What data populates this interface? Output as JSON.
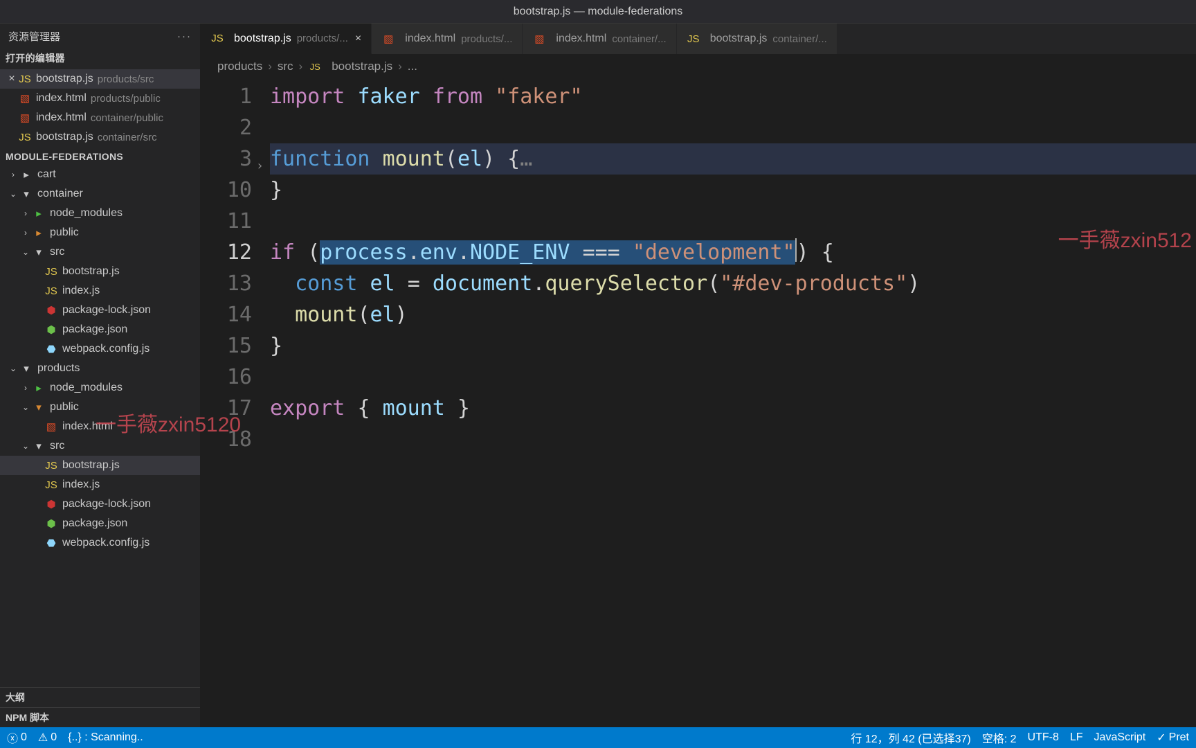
{
  "window_title": "bootstrap.js — module-federations",
  "sidebar": {
    "header": "资源管理器",
    "open_editors_label": "打开的编辑器",
    "project_label": "MODULE-FEDERATIONS",
    "outline_label": "大纲",
    "npm_label": "NPM 脚本"
  },
  "open_editors": [
    {
      "icon": "js",
      "name": "bootstrap.js",
      "path": "products/src",
      "active": true
    },
    {
      "icon": "html",
      "name": "index.html",
      "path": "products/public",
      "active": false
    },
    {
      "icon": "html",
      "name": "index.html",
      "path": "container/public",
      "active": false
    },
    {
      "icon": "js",
      "name": "bootstrap.js",
      "path": "container/src",
      "active": false
    }
  ],
  "tree": [
    {
      "indent": 0,
      "chev": "right",
      "icon": "folder",
      "name": "cart"
    },
    {
      "indent": 0,
      "chev": "down",
      "icon": "folder",
      "name": "container"
    },
    {
      "indent": 1,
      "chev": "right",
      "icon": "folder-green",
      "name": "node_modules"
    },
    {
      "indent": 1,
      "chev": "right",
      "icon": "folder-orange",
      "name": "public"
    },
    {
      "indent": 1,
      "chev": "down",
      "icon": "folder",
      "name": "src"
    },
    {
      "indent": 2,
      "chev": "",
      "icon": "js",
      "name": "bootstrap.js"
    },
    {
      "indent": 2,
      "chev": "",
      "icon": "js",
      "name": "index.js"
    },
    {
      "indent": 2,
      "chev": "",
      "icon": "npm",
      "name": "package-lock.json"
    },
    {
      "indent": 2,
      "chev": "",
      "icon": "nodejs",
      "name": "package.json"
    },
    {
      "indent": 2,
      "chev": "",
      "icon": "webpack",
      "name": "webpack.config.js"
    },
    {
      "indent": 0,
      "chev": "down",
      "icon": "folder",
      "name": "products"
    },
    {
      "indent": 1,
      "chev": "right",
      "icon": "folder-green",
      "name": "node_modules"
    },
    {
      "indent": 1,
      "chev": "down",
      "icon": "folder-orange",
      "name": "public"
    },
    {
      "indent": 2,
      "chev": "",
      "icon": "html",
      "name": "index.html"
    },
    {
      "indent": 1,
      "chev": "down",
      "icon": "folder",
      "name": "src"
    },
    {
      "indent": 2,
      "chev": "",
      "icon": "js",
      "name": "bootstrap.js",
      "active": true
    },
    {
      "indent": 2,
      "chev": "",
      "icon": "js",
      "name": "index.js"
    },
    {
      "indent": 2,
      "chev": "",
      "icon": "npm",
      "name": "package-lock.json"
    },
    {
      "indent": 2,
      "chev": "",
      "icon": "nodejs",
      "name": "package.json"
    },
    {
      "indent": 2,
      "chev": "",
      "icon": "webpack",
      "name": "webpack.config.js"
    }
  ],
  "tabs": [
    {
      "icon": "js",
      "name": "bootstrap.js",
      "path": "products/...",
      "active": true,
      "close": true
    },
    {
      "icon": "html",
      "name": "index.html",
      "path": "products/...",
      "active": false,
      "close": false
    },
    {
      "icon": "html",
      "name": "index.html",
      "path": "container/...",
      "active": false,
      "close": false
    },
    {
      "icon": "js",
      "name": "bootstrap.js",
      "path": "container/...",
      "active": false,
      "close": false
    }
  ],
  "breadcrumbs": [
    "products",
    "src",
    "bootstrap.js",
    "..."
  ],
  "code": {
    "lines": [
      "1",
      "2",
      "3",
      "10",
      "11",
      "12",
      "13",
      "14",
      "15",
      "16",
      "17",
      "18"
    ],
    "active_line": "12",
    "l1_import": "import",
    "l1_faker1": "faker",
    "l1_from": "from",
    "l1_faker2": "\"faker\"",
    "l3_function": "function",
    "l3_mount": "mount",
    "l3_el": "el",
    "l3_ellipsis": "…",
    "l10_brace": "}",
    "l12_if": "if",
    "l12_process": "process",
    "l12_env": "env",
    "l12_node": "NODE_ENV",
    "l12_eq": "===",
    "l12_dev": "\"development\"",
    "l13_const": "const",
    "l13_el": "el",
    "l13_doc": "document",
    "l13_qs": "querySelector",
    "l13_sel": "\"#dev-products\"",
    "l14_mount": "mount",
    "l14_el": "el",
    "l15_brace": "}",
    "l17_export": "export",
    "l17_mount": "mount"
  },
  "watermarks": {
    "w1": "一手薇zxin5120",
    "w2": "一手薇zxin512"
  },
  "status": {
    "errors": "0",
    "warnings": "0",
    "scanning": "{..} : Scanning..",
    "cursor": "行 12，列 42 (已选择37)",
    "spaces": "空格: 2",
    "encoding": "UTF-8",
    "eol": "LF",
    "lang": "JavaScript",
    "pret": "Pret"
  }
}
